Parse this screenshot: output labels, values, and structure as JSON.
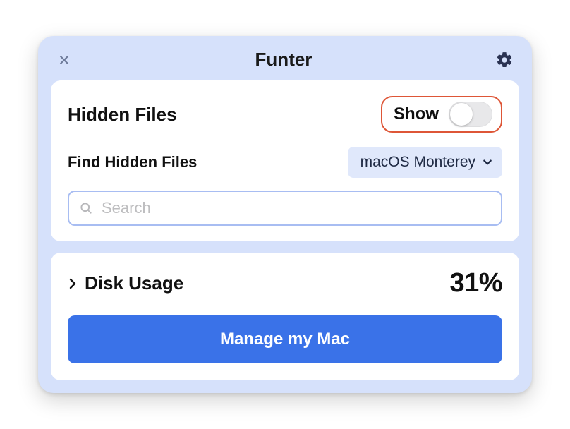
{
  "header": {
    "title": "Funter"
  },
  "panel1": {
    "hidden_files_label": "Hidden Files",
    "toggle_label": "Show",
    "find_label": "Find Hidden Files",
    "location_selected": "macOS Monterey",
    "search_placeholder": "Search"
  },
  "panel2": {
    "disk_label": "Disk Usage",
    "disk_pct": "31%",
    "manage_label": "Manage my Mac"
  }
}
